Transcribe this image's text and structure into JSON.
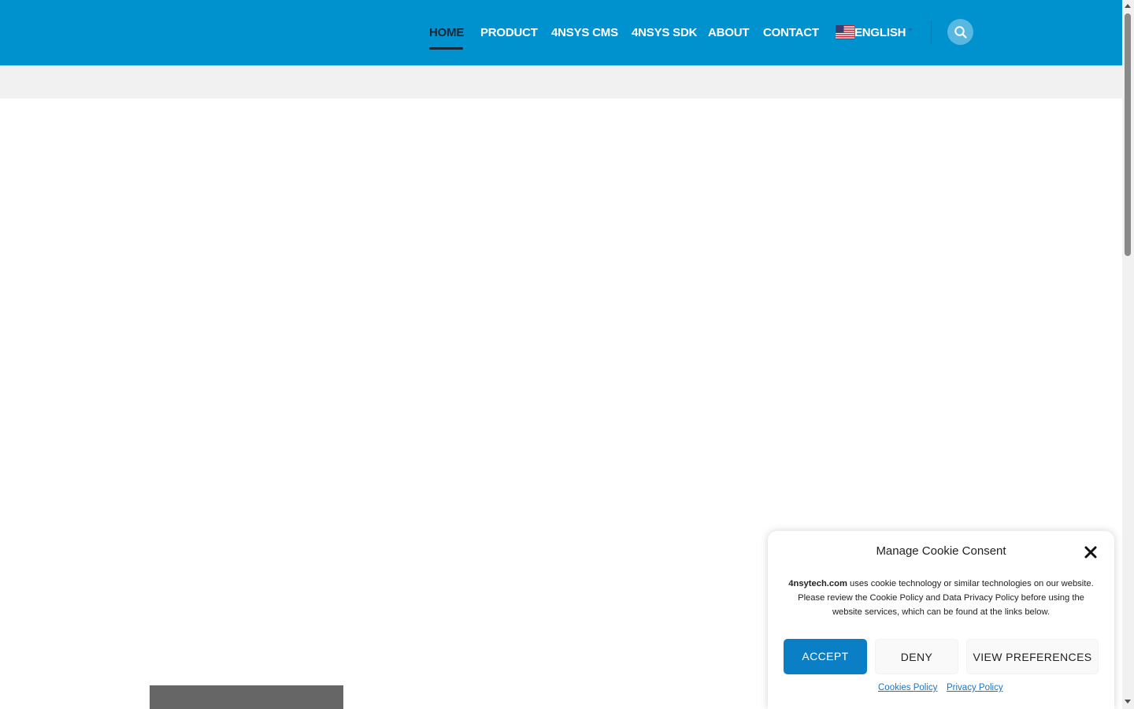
{
  "header": {
    "background": "#0092cf",
    "nav": [
      {
        "label": "HOME",
        "active": true
      },
      {
        "label": "PRODUCT",
        "active": false
      },
      {
        "label": "4NSYS CMS",
        "active": false
      },
      {
        "label": "4NSYS SDK",
        "active": false
      },
      {
        "label": "ABOUT",
        "active": false
      },
      {
        "label": "CONTACT",
        "active": false
      }
    ],
    "language": {
      "label": "ENGLISH",
      "flag": "us-flag-icon"
    },
    "search_icon": "search-icon"
  },
  "cookie": {
    "title": "Manage Cookie Consent",
    "site": "4nsytech.com",
    "text": " uses cookie technology or similar technologies on our website. Please review the Cookie Policy and Data Privacy Policy before using the website services, which can be found at the links below.",
    "accept": "ACCEPT",
    "deny": "DENY",
    "preferences": "VIEW PREFERENCES",
    "cookies_policy": "Cookies Policy",
    "privacy_policy": "Privacy Policy",
    "accent_color": "#0b7fc5"
  }
}
